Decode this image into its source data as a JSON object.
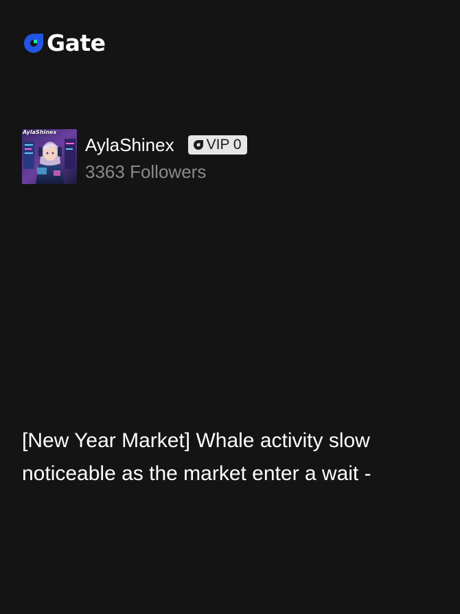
{
  "brand": {
    "name": "Gate",
    "logo_color": "#2354E6",
    "accent_color": "#17E6A1"
  },
  "profile": {
    "avatar_caption": "AylaShinex",
    "username": "AylaShinex",
    "vip_label": "VIP 0",
    "vip_icon": "gate-vip-icon",
    "followers_text": "3363 Followers"
  },
  "post": {
    "headline": "[New Year Market] Whale activity slow noticeable as the market enter a wait -"
  },
  "colors": {
    "background": "#141414",
    "text_primary": "#FFFFFF",
    "text_secondary": "#8A8A8A",
    "badge_bg": "#E6E6E6"
  }
}
